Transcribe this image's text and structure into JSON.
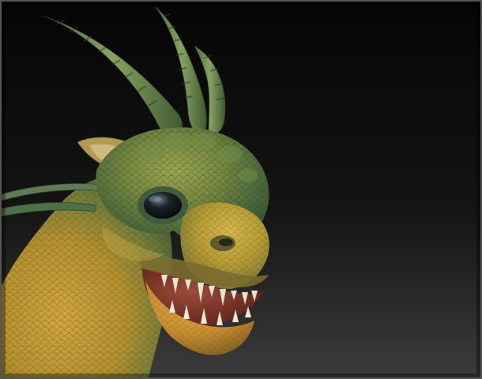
{
  "image": {
    "kind": "3d-sculpt-render",
    "palette": {
      "background_top": "#0a0a0a",
      "background_bottom": "#3a3a3a",
      "skin_green": "#5b7a3a",
      "skin_yellow": "#c9a437",
      "skin_orange": "#c77a2c",
      "eye": "#0c1418",
      "teeth": "#e9e3d2",
      "mouth": "#6b2a20"
    }
  }
}
